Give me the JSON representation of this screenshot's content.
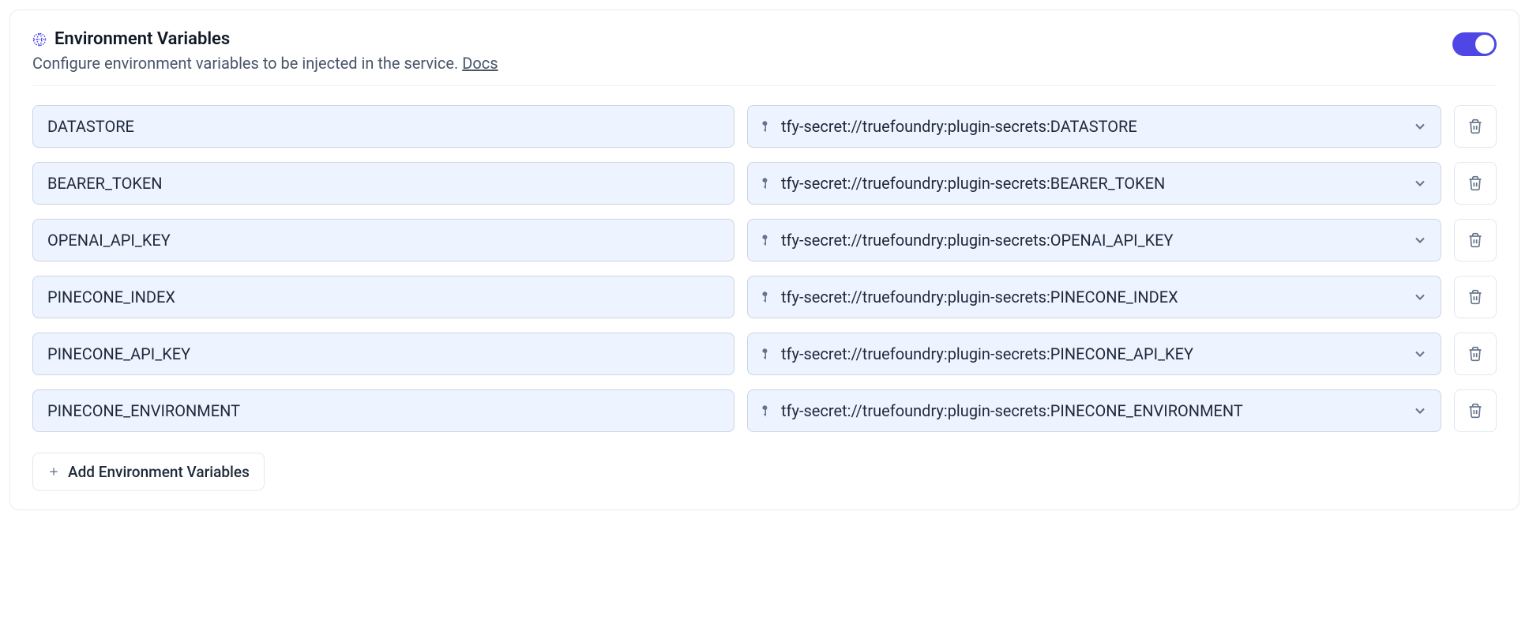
{
  "header": {
    "title": "Environment Variables",
    "subtitle_prefix": "Configure environment variables to be injected in the service. ",
    "docs_label": "Docs",
    "toggle_enabled": true
  },
  "rows": [
    {
      "name": "DATASTORE",
      "value": "tfy-secret://truefoundry:plugin-secrets:DATASTORE"
    },
    {
      "name": "BEARER_TOKEN",
      "value": "tfy-secret://truefoundry:plugin-secrets:BEARER_TOKEN"
    },
    {
      "name": "OPENAI_API_KEY",
      "value": "tfy-secret://truefoundry:plugin-secrets:OPENAI_API_KEY"
    },
    {
      "name": "PINECONE_INDEX",
      "value": "tfy-secret://truefoundry:plugin-secrets:PINECONE_INDEX"
    },
    {
      "name": "PINECONE_API_KEY",
      "value": "tfy-secret://truefoundry:plugin-secrets:PINECONE_API_KEY"
    },
    {
      "name": "PINECONE_ENVIRONMENT",
      "value": "tfy-secret://truefoundry:plugin-secrets:PINECONE_ENVIRONMENT"
    }
  ],
  "add_button_label": "Add Environment Variables"
}
